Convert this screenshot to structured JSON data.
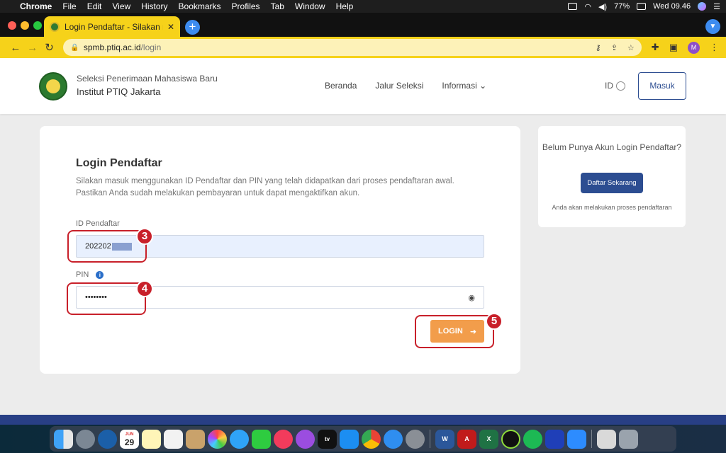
{
  "menubar": {
    "app": "Chrome",
    "items": [
      "File",
      "Edit",
      "View",
      "History",
      "Bookmarks",
      "Profiles",
      "Tab",
      "Window",
      "Help"
    ],
    "battery": "77%",
    "clock": "Wed 09.46"
  },
  "tab": {
    "title": "Login Pendaftar - Silakan masu"
  },
  "omnibox": {
    "domain": "spmb.ptiq.ac.id",
    "path": "/login"
  },
  "profile": {
    "initial": "M"
  },
  "site": {
    "brand_sub": "Seleksi Penerimaan Mahasiswa Baru",
    "brand_main": "Institut PTIQ Jakarta",
    "nav": [
      "Beranda",
      "Jalur Seleksi",
      "Informasi"
    ],
    "lang": "ID",
    "masuk": "Masuk"
  },
  "login": {
    "title": "Login Pendaftar",
    "desc": "Silakan masuk menggunakan ID Pendaftar dan PIN yang telah didapatkan dari proses pendaftaran awal. Pastikan Anda sudah melakukan pembayaran untuk dapat mengaktifkan akun.",
    "id_label": "ID Pendaftar",
    "id_value": "202202",
    "pin_label": "PIN",
    "pin_value": "••••••••",
    "button": "LOGIN"
  },
  "annotations": [
    "3",
    "4",
    "5"
  ],
  "sidebar": {
    "question": "Belum Punya Akun Login Pendaftar?",
    "button": "Daftar Sekarang",
    "note": "Anda akan melakukan proses pendaftaran"
  },
  "dock": {
    "calendar_day": "29",
    "calendar_month": "JUN"
  },
  "colors": {
    "chrome_theme": "#f6d21a",
    "primary": "#2c4d91",
    "login_button": "#f29d4b",
    "annotation": "#c8202a"
  }
}
